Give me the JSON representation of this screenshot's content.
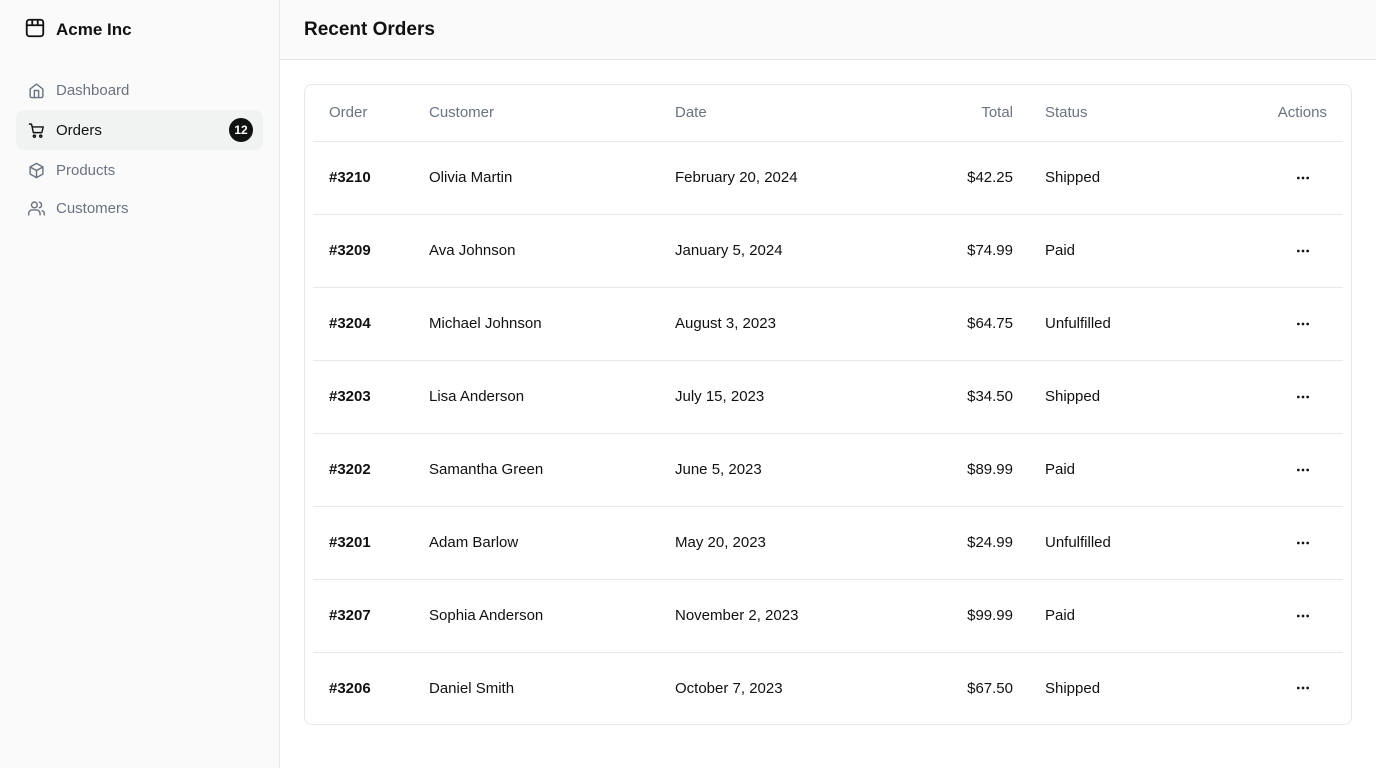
{
  "brand": {
    "name": "Acme Inc",
    "icon": "package-icon"
  },
  "sidebar": {
    "items": [
      {
        "label": "Dashboard",
        "icon": "home-icon",
        "active": false
      },
      {
        "label": "Orders",
        "icon": "cart-icon",
        "active": true,
        "badge": "12"
      },
      {
        "label": "Products",
        "icon": "box-icon",
        "active": false
      },
      {
        "label": "Customers",
        "icon": "users-icon",
        "active": false
      }
    ]
  },
  "header": {
    "title": "Recent Orders"
  },
  "table": {
    "columns": [
      "Order",
      "Customer",
      "Date",
      "Total",
      "Status",
      "Actions"
    ],
    "rows": [
      {
        "order": "#3210",
        "customer": "Olivia Martin",
        "date": "February 20, 2024",
        "total": "$42.25",
        "status": "Shipped"
      },
      {
        "order": "#3209",
        "customer": "Ava Johnson",
        "date": "January 5, 2024",
        "total": "$74.99",
        "status": "Paid"
      },
      {
        "order": "#3204",
        "customer": "Michael Johnson",
        "date": "August 3, 2023",
        "total": "$64.75",
        "status": "Unfulfilled"
      },
      {
        "order": "#3203",
        "customer": "Lisa Anderson",
        "date": "July 15, 2023",
        "total": "$34.50",
        "status": "Shipped"
      },
      {
        "order": "#3202",
        "customer": "Samantha Green",
        "date": "June 5, 2023",
        "total": "$89.99",
        "status": "Paid"
      },
      {
        "order": "#3201",
        "customer": "Adam Barlow",
        "date": "May 20, 2023",
        "total": "$24.99",
        "status": "Unfulfilled"
      },
      {
        "order": "#3207",
        "customer": "Sophia Anderson",
        "date": "November 2, 2023",
        "total": "$99.99",
        "status": "Paid"
      },
      {
        "order": "#3206",
        "customer": "Daniel Smith",
        "date": "October 7, 2023",
        "total": "$67.50",
        "status": "Shipped"
      }
    ]
  }
}
